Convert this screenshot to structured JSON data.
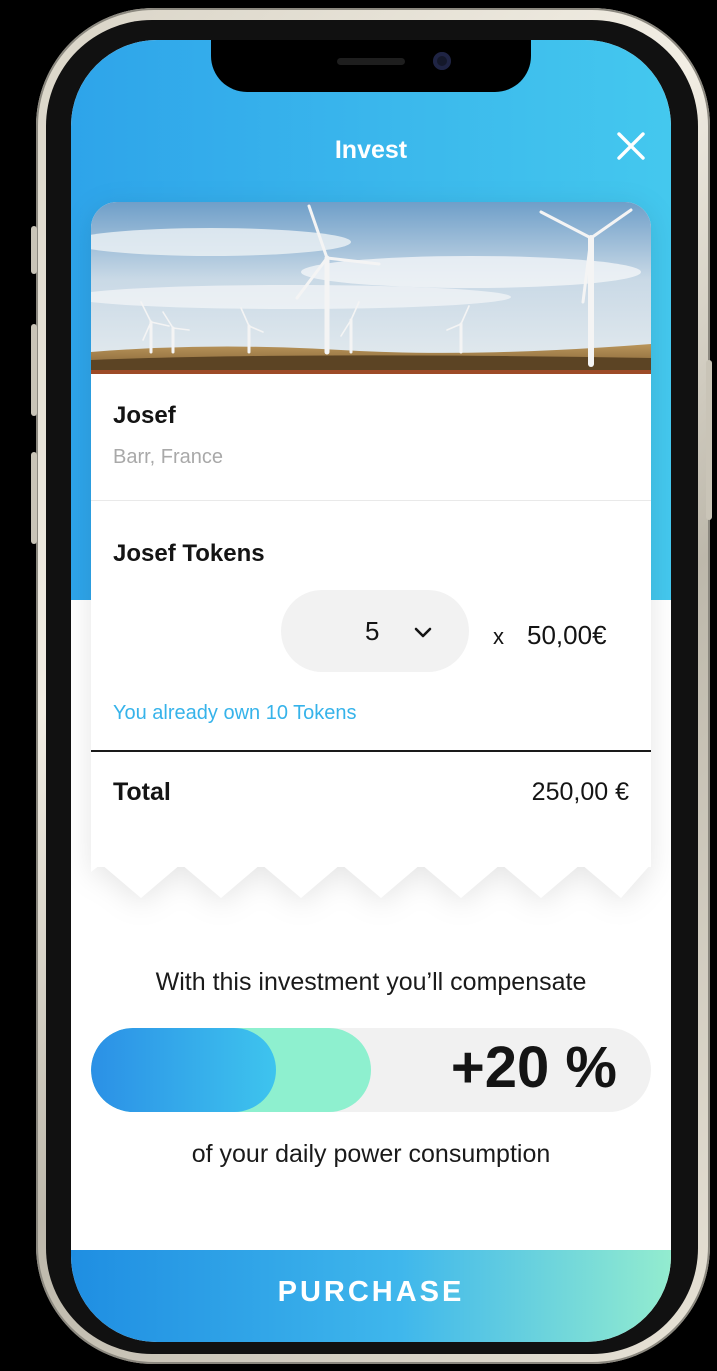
{
  "header": {
    "title": "Invest",
    "close_icon": "close-icon"
  },
  "project": {
    "name": "Josef",
    "location": "Barr, France",
    "image": "wind-turbines-photo"
  },
  "tokens": {
    "label": "Josef Tokens",
    "quantity": "5",
    "multiplier": "x",
    "unit_price": "50,00€",
    "owned_note": "You already own 10 Tokens"
  },
  "total": {
    "label": "Total",
    "value": "250,00 €"
  },
  "compensation": {
    "intro": "With this investment you’ll compensate",
    "percent_label": "+20 %",
    "outro": "of your daily power consumption",
    "existing_share": 0.33,
    "new_share": 0.5
  },
  "actions": {
    "purchase_label": "PURCHASE"
  },
  "colors": {
    "accent_blue": "#3bb8ec",
    "accent_mint": "#8ef0cf",
    "link_blue": "#36b3ea"
  }
}
